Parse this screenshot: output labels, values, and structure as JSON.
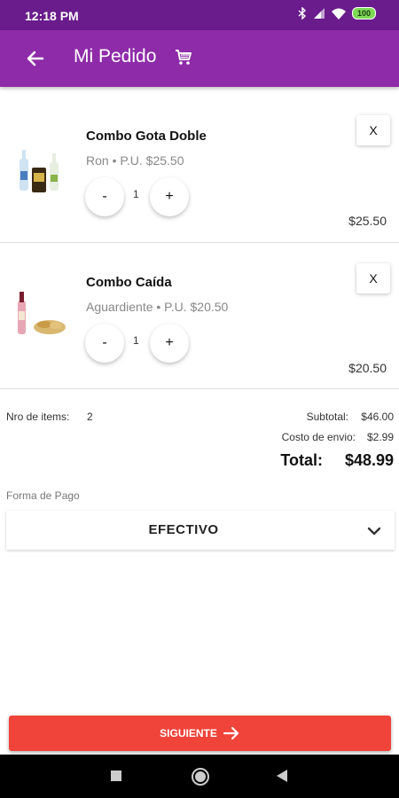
{
  "status": {
    "time": "12:18 PM",
    "battery": "100"
  },
  "header": {
    "title": "Mi Pedido",
    "back_icon": "arrow-left-icon",
    "cart_icon": "cart-icon",
    "color": "#8e2ba8"
  },
  "items": [
    {
      "name": "Combo Gota Doble",
      "subtitle": "Ron • P.U. $25.50",
      "qty": "1",
      "price": "$25.50",
      "remove": "X",
      "minus": "-",
      "plus": "+"
    },
    {
      "name": "Combo Caída",
      "subtitle": "Aguardiente • P.U. $20.50",
      "qty": "1",
      "price": "$20.50",
      "remove": "X",
      "minus": "-",
      "plus": "+"
    }
  ],
  "summary": {
    "items_label": "Nro de items:",
    "items_count": "2",
    "subtotal_label": "Subtotal:",
    "subtotal": "$46.00",
    "shipping_label": "Costo de envio:",
    "shipping": "$2.99",
    "total_label": "Total:",
    "total": "$48.99"
  },
  "payment": {
    "label": "Forma de Pago",
    "value": "EFECTIVO"
  },
  "next_button": {
    "label": "SIGUIENTE",
    "color": "#f0433a"
  }
}
